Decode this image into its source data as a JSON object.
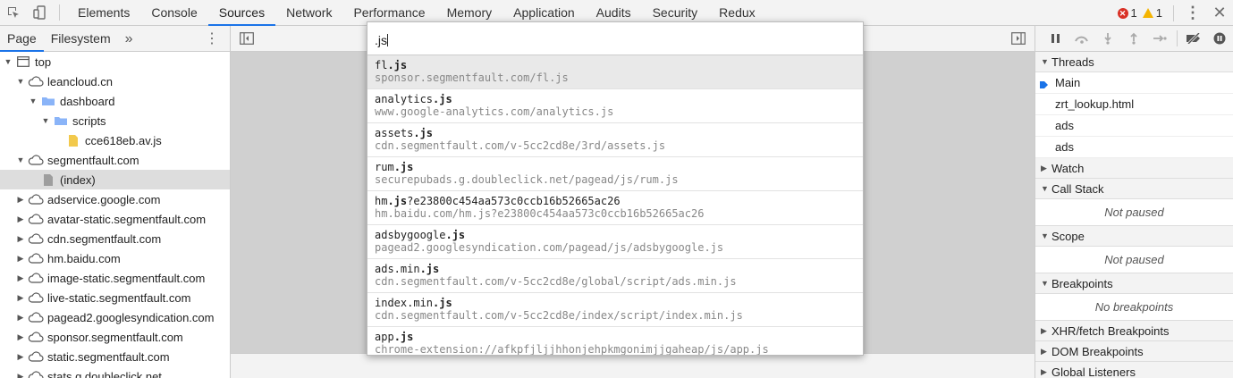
{
  "toolbar": {
    "tabs": [
      "Elements",
      "Console",
      "Sources",
      "Network",
      "Performance",
      "Memory",
      "Application",
      "Audits",
      "Security",
      "Redux"
    ],
    "active_tab": "Sources",
    "error_count": "1",
    "warning_count": "1"
  },
  "navigator": {
    "tabs": [
      "Page",
      "Filesystem"
    ],
    "more_label": "»",
    "tree": [
      {
        "label": "top",
        "icon": "frame-icon",
        "depth": 0,
        "expanded": true
      },
      {
        "label": "leancloud.cn",
        "icon": "cloud-icon",
        "depth": 1,
        "expanded": true
      },
      {
        "label": "dashboard",
        "icon": "folder-icon",
        "depth": 2,
        "expanded": true
      },
      {
        "label": "scripts",
        "icon": "folder-icon",
        "depth": 3,
        "expanded": true
      },
      {
        "label": "cce618eb.av.js",
        "icon": "js-file-icon",
        "depth": 4,
        "expanded": null
      },
      {
        "label": "segmentfault.com",
        "icon": "cloud-icon",
        "depth": 1,
        "expanded": true
      },
      {
        "label": "(index)",
        "icon": "document-icon",
        "depth": 2,
        "expanded": null,
        "selected": true
      },
      {
        "label": "adservice.google.com",
        "icon": "cloud-icon",
        "depth": 1,
        "expanded": false
      },
      {
        "label": "avatar-static.segmentfault.com",
        "icon": "cloud-icon",
        "depth": 1,
        "expanded": false
      },
      {
        "label": "cdn.segmentfault.com",
        "icon": "cloud-icon",
        "depth": 1,
        "expanded": false
      },
      {
        "label": "hm.baidu.com",
        "icon": "cloud-icon",
        "depth": 1,
        "expanded": false
      },
      {
        "label": "image-static.segmentfault.com",
        "icon": "cloud-icon",
        "depth": 1,
        "expanded": false
      },
      {
        "label": "live-static.segmentfault.com",
        "icon": "cloud-icon",
        "depth": 1,
        "expanded": false
      },
      {
        "label": "pagead2.googlesyndication.com",
        "icon": "cloud-icon",
        "depth": 1,
        "expanded": false
      },
      {
        "label": "sponsor.segmentfault.com",
        "icon": "cloud-icon",
        "depth": 1,
        "expanded": false
      },
      {
        "label": "static.segmentfault.com",
        "icon": "cloud-icon",
        "depth": 1,
        "expanded": false
      },
      {
        "label": "stats.g.doubleclick.net",
        "icon": "cloud-icon",
        "depth": 1,
        "expanded": false
      }
    ]
  },
  "quick_open": {
    "query": ".js",
    "items": [
      {
        "pre": "fl",
        "match": ".js",
        "post": "",
        "url": "sponsor.segmentfault.com/fl.js",
        "selected": true
      },
      {
        "pre": "analytics",
        "match": ".js",
        "post": "",
        "url": "www.google-analytics.com/analytics.js"
      },
      {
        "pre": "assets",
        "match": ".js",
        "post": "",
        "url": "cdn.segmentfault.com/v-5cc2cd8e/3rd/assets.js"
      },
      {
        "pre": "rum",
        "match": ".js",
        "post": "",
        "url": "securepubads.g.doubleclick.net/pagead/js/rum.js"
      },
      {
        "pre": "hm",
        "match": ".js",
        "post": "?e23800c454aa573c0ccb16b52665ac26",
        "url": "hm.baidu.com/hm.js?e23800c454aa573c0ccb16b52665ac26"
      },
      {
        "pre": "adsbygoogle",
        "match": ".js",
        "post": "",
        "url": "pagead2.googlesyndication.com/pagead/js/adsbygoogle.js"
      },
      {
        "pre": "ads.min",
        "match": ".js",
        "post": "",
        "url": "cdn.segmentfault.com/v-5cc2cd8e/global/script/ads.min.js"
      },
      {
        "pre": "index.min",
        "match": ".js",
        "post": "",
        "url": "cdn.segmentfault.com/v-5cc2cd8e/index/script/index.min.js"
      },
      {
        "pre": "app",
        "match": ".js",
        "post": "",
        "url": "chrome-extension://afkpfjljjhhonjehpkmgonimjjgaheap/js/app.js"
      }
    ]
  },
  "debugger": {
    "threads_title": "Threads",
    "threads": [
      "Main",
      "zrt_lookup.html",
      "ads",
      "ads"
    ],
    "watch_title": "Watch",
    "call_stack_title": "Call Stack",
    "call_stack_empty": "Not paused",
    "scope_title": "Scope",
    "scope_empty": "Not paused",
    "breakpoints_title": "Breakpoints",
    "breakpoints_empty": "No breakpoints",
    "xhr_title": "XHR/fetch Breakpoints",
    "dom_title": "DOM Breakpoints",
    "global_title": "Global Listeners"
  },
  "colors": {
    "accent": "#1a73e8",
    "error": "#d93025",
    "warning": "#f4b400",
    "folder": "#8ab4f8",
    "js_file": "#f2c94c"
  }
}
